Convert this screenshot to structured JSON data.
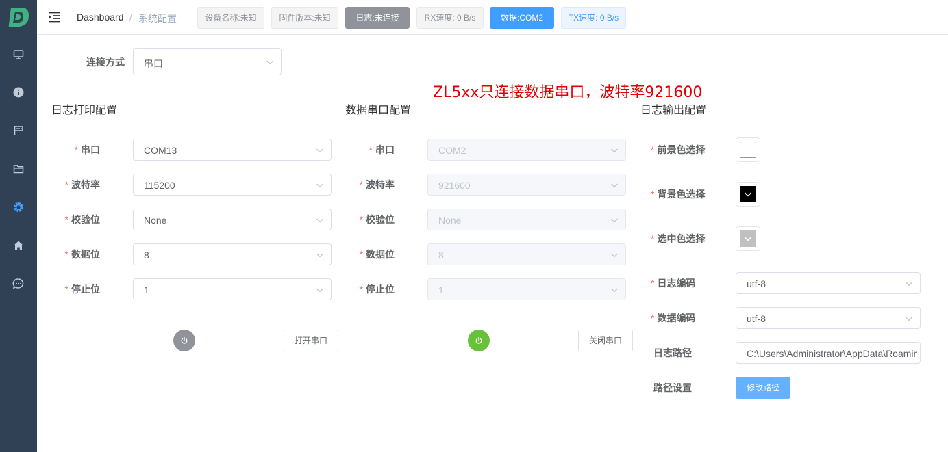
{
  "sidebar": {
    "items": [
      {
        "icon": "monitor-icon"
      },
      {
        "icon": "info-icon"
      },
      {
        "icon": "flag-icon"
      },
      {
        "icon": "folder-icon"
      },
      {
        "icon": "gear-icon",
        "active": true
      },
      {
        "icon": "home-icon"
      },
      {
        "icon": "chat-icon"
      }
    ],
    "active_color": "#409eff"
  },
  "header": {
    "breadcrumb_home": "Dashboard",
    "breadcrumb_sep": "/",
    "breadcrumb_current": "系统配置",
    "tags": {
      "device_name": "设备名称:未知",
      "firmware": "固件版本:未知",
      "log_status": "日志:未连接",
      "rx_speed": "RX速度: 0 B/s",
      "data_port": "数据:COM2",
      "tx_speed": "TX速度: 0 B/s"
    }
  },
  "connection": {
    "label": "连接方式",
    "value": "串口"
  },
  "annotation": "ZL5xx只连接数据串口，波特率921600",
  "log_print": {
    "title": "日志打印配置",
    "fields": [
      {
        "label": "串口",
        "value": "COM13"
      },
      {
        "label": "波特率",
        "value": "115200"
      },
      {
        "label": "校验位",
        "value": "None"
      },
      {
        "label": "数据位",
        "value": "8"
      },
      {
        "label": "停止位",
        "value": "1"
      }
    ],
    "button": "打开串口",
    "power_color": "#909399"
  },
  "data_port": {
    "title": "数据串口配置",
    "fields": [
      {
        "label": "串口",
        "value": "COM2"
      },
      {
        "label": "波特率",
        "value": "921600"
      },
      {
        "label": "校验位",
        "value": "None"
      },
      {
        "label": "数据位",
        "value": "8"
      },
      {
        "label": "停止位",
        "value": "1"
      }
    ],
    "button": "关闭串口",
    "power_color": "#67c23a"
  },
  "log_output": {
    "title": "日志输出配置",
    "foreground_label": "前景色选择",
    "foreground_color": "#ffffff",
    "background_label": "背景色选择",
    "background_color": "#000000",
    "selected_label": "选中色选择",
    "selected_color": "#c0c0c0",
    "log_encoding_label": "日志编码",
    "log_encoding": "utf-8",
    "data_encoding_label": "数据编码",
    "data_encoding": "utf-8",
    "log_path_label": "日志路径",
    "log_path": "C:\\Users\\Administrator\\AppData\\Roaming",
    "path_setting_label": "路径设置",
    "modify_path_button": "修改路径"
  }
}
